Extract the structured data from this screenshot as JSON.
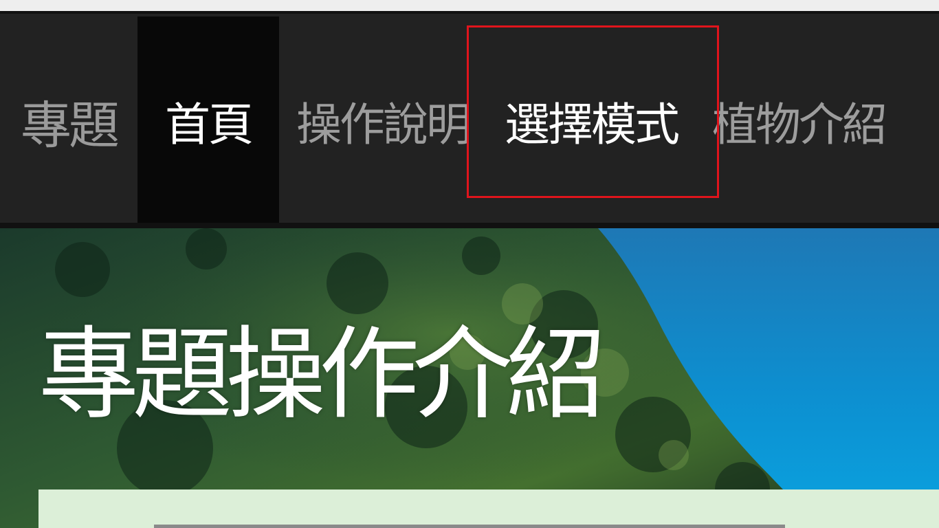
{
  "navbar": {
    "brand": "專題",
    "items": [
      {
        "label": "首頁",
        "active": true
      },
      {
        "label": "操作說明",
        "active": false
      },
      {
        "label": "選擇模式",
        "active": false,
        "highlighted": true
      },
      {
        "label": "植物介紹",
        "active": false
      }
    ]
  },
  "hero": {
    "title": "專題操作介紹"
  },
  "colors": {
    "navbar_bg": "#222222",
    "active_item_bg": "#080808",
    "highlight_border": "#e0141c",
    "content_panel_bg": "#dcefd8"
  }
}
